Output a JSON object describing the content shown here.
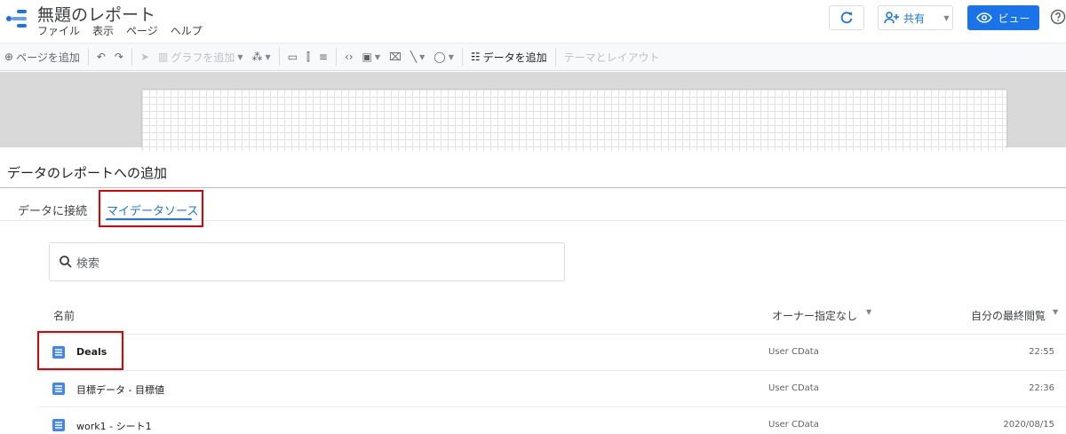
{
  "header": {
    "title": "無題のレポート",
    "menu": [
      "ファイル",
      "表示",
      "ページ",
      "ヘルプ"
    ],
    "share_label": "共有",
    "view_label": "ビュー"
  },
  "toolbar": {
    "add_page": "ページを追加",
    "add_chart": "グラフを追加",
    "add_data": "データを追加",
    "theme_layout": "テーマとレイアウト"
  },
  "panel": {
    "title": "データのレポートへの追加",
    "tabs": [
      "データに接続",
      "マイデータソース"
    ],
    "active_tab": "マイデータソース",
    "search_placeholder": "検索",
    "columns": {
      "name": "名前",
      "owner": "オーナー指定なし",
      "last_viewed": "自分の最終閲覧"
    },
    "rows": [
      {
        "name": "Deals",
        "owner": "User CData",
        "time": "22:55"
      },
      {
        "name": "目標データ - 目標値",
        "owner": "User CData",
        "time": "22:36"
      },
      {
        "name": "work1 - シート1",
        "owner": "User CData",
        "time": "2020/08/15"
      }
    ]
  },
  "colors": {
    "accent": "#1a73e8",
    "highlight": "#e00000",
    "doc_icon": "#4285f4"
  },
  "icons": [
    "logo-icon",
    "refresh-icon",
    "add-person-icon",
    "eye-icon",
    "help-icon",
    "search-icon",
    "doc-icon"
  ]
}
